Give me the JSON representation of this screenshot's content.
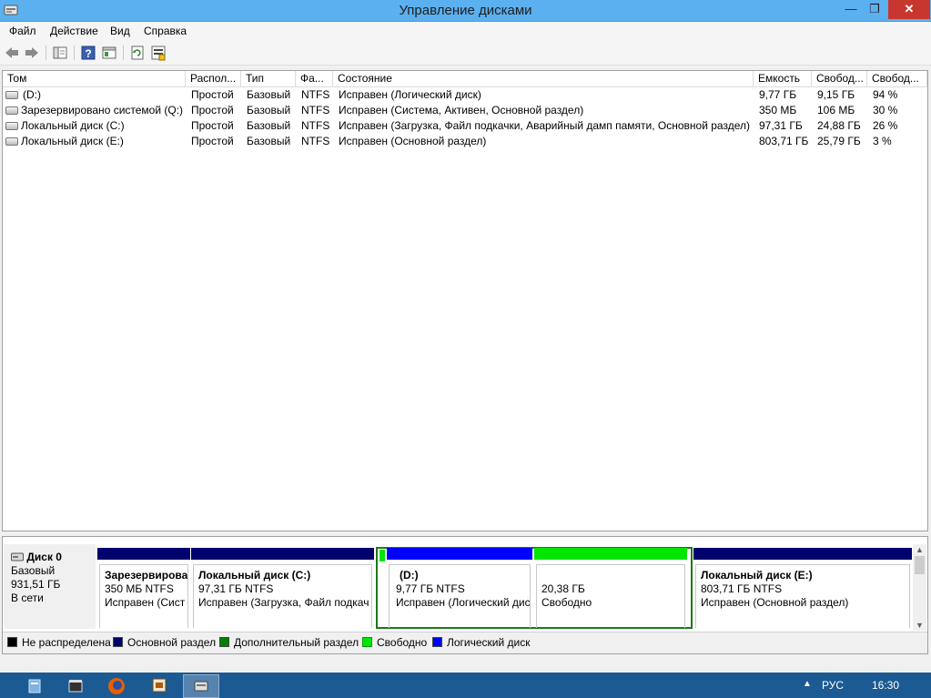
{
  "window": {
    "title": "Управление дисками",
    "min": "—",
    "max": "❐",
    "close": "✕"
  },
  "menu": [
    "Файл",
    "Действие",
    "Вид",
    "Справка"
  ],
  "toolbar_icons": [
    "back-arrow-icon",
    "forward-arrow-icon",
    "console-tree-icon",
    "help-icon",
    "properties-icon",
    "refresh-icon",
    "settings-icon"
  ],
  "columns": [
    "Том",
    "Распол...",
    "Тип",
    "Фа...",
    "Состояние",
    "Емкость",
    "Свобод...",
    "Свобод..."
  ],
  "rows": [
    [
      "(D:)",
      "Простой",
      "Базовый",
      "NTFS",
      "Исправен (Логический диск)",
      "9,77 ГБ",
      "9,15 ГБ",
      "94 %"
    ],
    [
      "Зарезервировано системой (Q:)",
      "Простой",
      "Базовый",
      "NTFS",
      "Исправен (Система, Активен, Основной раздел)",
      "350 МБ",
      "106 МБ",
      "30 %"
    ],
    [
      "Локальный диск (C:)",
      "Простой",
      "Базовый",
      "NTFS",
      "Исправен (Загрузка, Файл подкачки, Аварийный дамп памяти, Основной раздел)",
      "97,31 ГБ",
      "24,88 ГБ",
      "26 %"
    ],
    [
      "Локальный диск (E:)",
      "Простой",
      "Базовый",
      "NTFS",
      "Исправен (Основной раздел)",
      "803,71 ГБ",
      "25,79 ГБ",
      "3 %"
    ]
  ],
  "disk": {
    "name": "Диск 0",
    "type": "Базовый",
    "size": "931,51 ГБ",
    "status": "В сети"
  },
  "partitions": [
    {
      "name": "Зарезервирова",
      "size": "350 МБ NTFS",
      "status": "Исправен (Сист",
      "bar_color": "#00006e"
    },
    {
      "name": "Локальный диск  (C:)",
      "size": "97,31 ГБ NTFS",
      "status": "Исправен (Загрузка, Файл подкач",
      "bar_color": "#00006e"
    },
    {
      "name": "(D:)",
      "size": "9,77 ГБ NTFS",
      "status": "Исправен (Логический дис",
      "bar_color": "#0000ff"
    },
    {
      "name": "",
      "size": "20,38 ГБ",
      "status": "Свободно",
      "bar_color": "#00e600"
    },
    {
      "name": "Локальный диск  (E:)",
      "size": "803,71 ГБ NTFS",
      "status": "Исправен (Основной раздел)",
      "bar_color": "#00006e"
    }
  ],
  "legend": [
    {
      "label": "Не распределена",
      "color": "#000000"
    },
    {
      "label": "Основной раздел",
      "color": "#00006e"
    },
    {
      "label": "Дополнительный раздел",
      "color": "#008000"
    },
    {
      "label": "Свободно",
      "color": "#00e600"
    },
    {
      "label": "Логический диск",
      "color": "#0000ff"
    }
  ],
  "taskbar": {
    "apps": [
      "file-explorer-icon",
      "media-player-icon",
      "firefox-icon",
      "presentation-icon",
      "disk-management-icon"
    ],
    "tray": {
      "language": "РУС",
      "time": "16:30"
    }
  }
}
